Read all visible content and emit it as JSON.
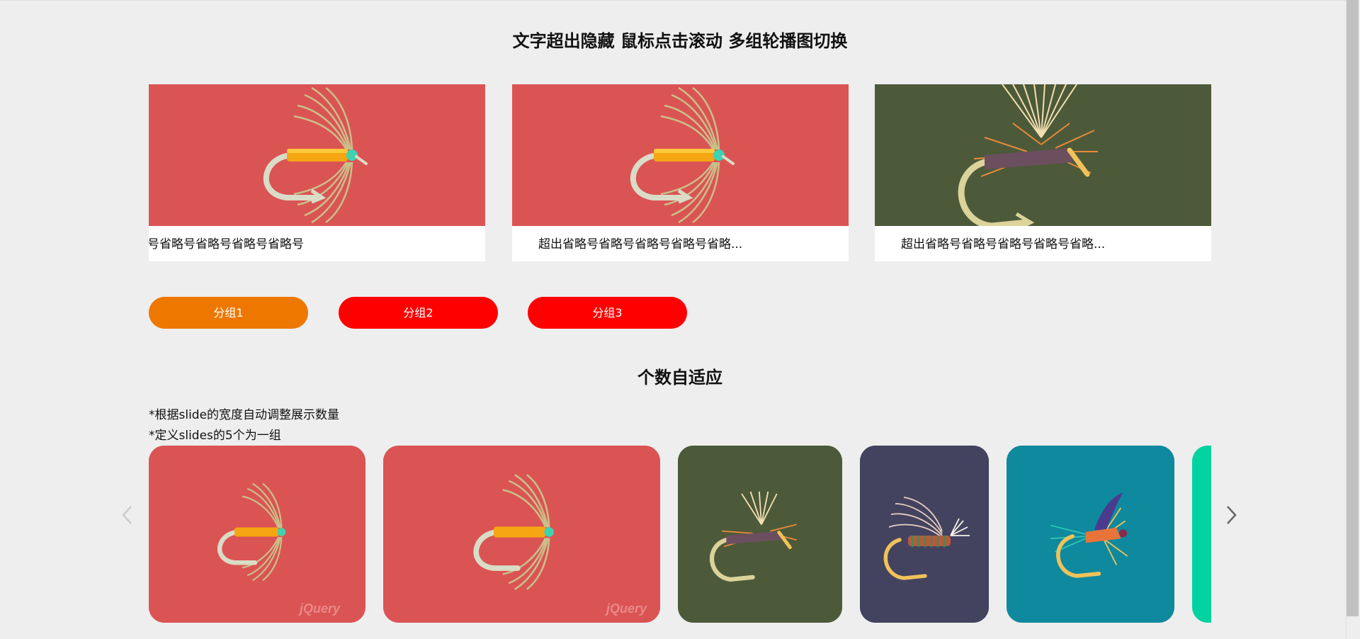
{
  "section1": {
    "title": "文字超出隐藏 鼠标点击滚动 多组轮播图切换"
  },
  "cards": [
    {
      "caption": "号省略号省略号省略号省略号",
      "bg": "#db5454",
      "image": "fly-red"
    },
    {
      "caption": "超出省略号省略号省略号省略号省略...",
      "bg": "#db5454",
      "image": "fly-red"
    },
    {
      "caption": "超出省略号省略号省略号省略号省略...",
      "bg": "#4d5a3a",
      "image": "fly-olive"
    }
  ],
  "groups": [
    {
      "label": "分组1",
      "color": "#ee7700",
      "active": true
    },
    {
      "label": "分组2",
      "color": "#ff0000",
      "active": false
    },
    {
      "label": "分组3",
      "color": "#ff0000",
      "active": false
    }
  ],
  "section2": {
    "title": "个数自适应",
    "notes": [
      "*根据slide的宽度自动调整展示数量",
      "*定义slides的5个为一组"
    ]
  },
  "tiles": [
    {
      "bg": "#db5454",
      "image": "fly-red",
      "watermark": "jQuery"
    },
    {
      "bg": "#db5454",
      "image": "fly-red",
      "watermark": "jQuery"
    },
    {
      "bg": "#4d5a3a",
      "image": "fly-olive"
    },
    {
      "bg": "#434360",
      "image": "fly-navy"
    },
    {
      "bg": "#0f899e",
      "image": "fly-teal"
    },
    {
      "bg": "#00d3a0",
      "image": ""
    }
  ],
  "nav": {
    "prev_icon": "chevron-left-icon",
    "next_icon": "chevron-right-icon"
  }
}
